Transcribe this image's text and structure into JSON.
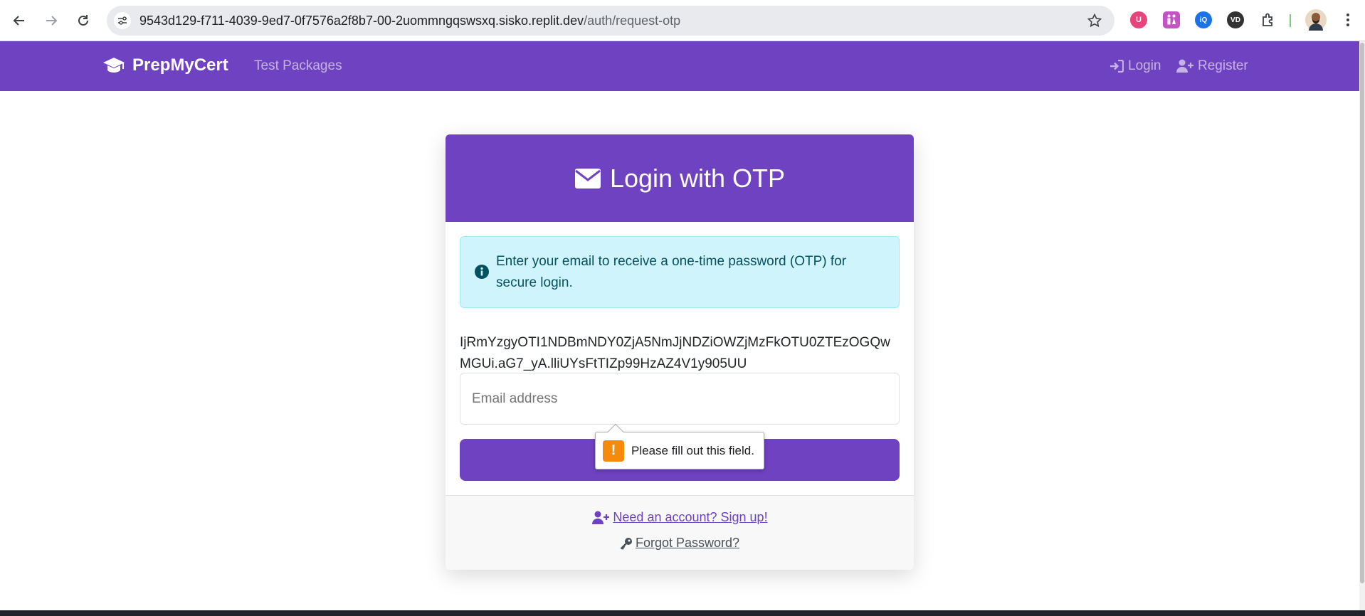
{
  "browser": {
    "url_host": "9543d129-f711-4039-9ed7-0f7576a2f8b7-00-2uommngqswsxq.sisko.replit.dev",
    "url_path": "/auth/request-otp",
    "extensions": [
      {
        "name": "ublock-icon",
        "color": "#e8437a",
        "label": "U"
      },
      {
        "name": "restroom-icon",
        "color": "#c653c6",
        "label": "⚲"
      },
      {
        "name": "iq-icon",
        "color": "#1a73e8",
        "label": "iQ"
      },
      {
        "name": "vd-icon",
        "color": "#333333",
        "label": "VD"
      }
    ]
  },
  "navbar": {
    "brand": "PrepMyCert",
    "links": {
      "test_packages": "Test Packages",
      "login": "Login",
      "register": "Register"
    },
    "brand_color": "#6f42c1"
  },
  "card": {
    "title": "Login with OTP",
    "alert_text": "Enter your email to receive a one-time password (OTP) for secure login.",
    "token_text": "IjRmYzgyOTI1NDBmNDY0ZjA5NmJjNDZiOWZjMzFkOTU0ZTEzOGQwMGUi.aG7_yA.lliUYsFtTIZp99HzAZ4V1y905UU",
    "email_placeholder": "Email address",
    "footer": {
      "signup_link": "Need an account? Sign up!",
      "forgot_link": "Forgot Password?"
    }
  },
  "tooltip": {
    "message": "Please fill out this field."
  }
}
